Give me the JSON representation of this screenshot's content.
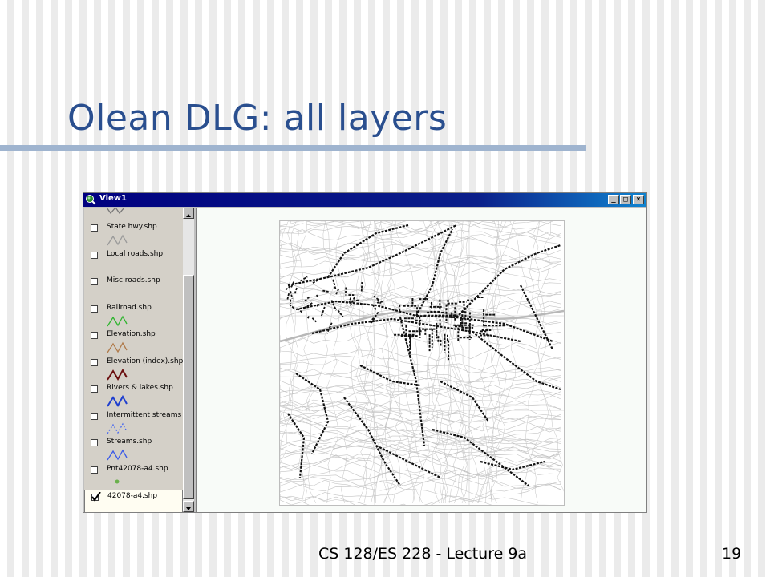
{
  "slide": {
    "title": "Olean DLG: all layers",
    "footer": "CS 128/ES 228 - Lecture 9a",
    "page_number": "19"
  },
  "window": {
    "title": "View1",
    "app_icon": "magnifier-globe-icon",
    "controls": {
      "minimize": "_",
      "restore": "□",
      "close": "×"
    }
  },
  "legend": {
    "items": [
      {
        "label": "State hwy.shp",
        "checked": false,
        "symbol": "line",
        "color": "#9a9a9a"
      },
      {
        "label": "Local roads.shp",
        "checked": false,
        "symbol": "none",
        "color": ""
      },
      {
        "label": "Misc roads.shp",
        "checked": false,
        "symbol": "none",
        "color": ""
      },
      {
        "label": "Railroad.shp",
        "checked": false,
        "symbol": "line",
        "color": "#2fb52f"
      },
      {
        "label": "Elevation.shp",
        "checked": false,
        "symbol": "line",
        "color": "#b07a4a"
      },
      {
        "label": "Elevation (index).shp",
        "checked": false,
        "symbol": "line",
        "color": "#6b0f0f"
      },
      {
        "label": "Rivers & lakes.shp",
        "checked": false,
        "symbol": "line",
        "color": "#1f3fcf"
      },
      {
        "label": "Intermittent streams",
        "checked": false,
        "symbol": "dashed",
        "color": "#4a6af0"
      },
      {
        "label": "Streams.shp",
        "checked": false,
        "symbol": "line",
        "color": "#3a5ae8"
      },
      {
        "label": "Pnt42078-a4.shp",
        "checked": false,
        "symbol": "point",
        "color": "#6ab04c"
      },
      {
        "label": "42078-a4.shp",
        "checked": true,
        "symbol": "none",
        "color": ""
      }
    ]
  },
  "colors": {
    "title_blue": "#2a4f8f",
    "rule": "#9fb4cf",
    "titlebar": "#000080",
    "road_dark": "#111111",
    "contour": "#c4c4c4"
  }
}
